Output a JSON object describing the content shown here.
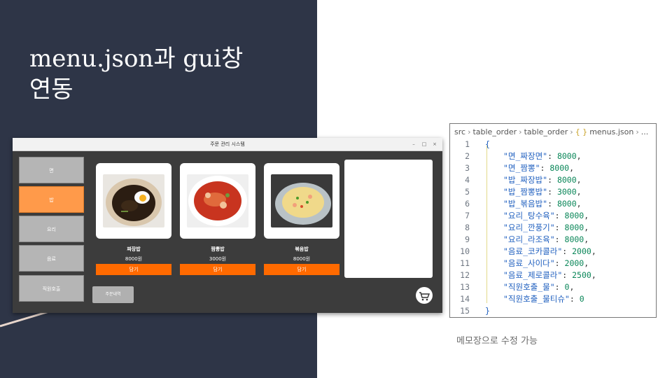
{
  "slide": {
    "title_line1": "menu.json과 gui창",
    "title_line2": "연동",
    "caption": "메모장으로 수정 가능",
    "colors": {
      "panel_bg": "#2e3547",
      "accent_orange": "#ff6a00",
      "active_category": "#ff9a4a"
    }
  },
  "app": {
    "window_title": "주문 관리 시스템",
    "window_controls": {
      "minimize": "–",
      "maximize": "□",
      "close": "×"
    },
    "categories": [
      {
        "label": "면",
        "active": false
      },
      {
        "label": "밥",
        "active": true
      },
      {
        "label": "요리",
        "active": false
      },
      {
        "label": "음료",
        "active": false
      },
      {
        "label": "직원호출",
        "active": false
      }
    ],
    "menu_items": [
      {
        "name": "짜장밥",
        "price": "8000원",
        "button": "담기",
        "image": "jjajang-rice-image"
      },
      {
        "name": "짬뽕밥",
        "price": "3000원",
        "button": "담기",
        "image": "jjamppong-rice-image"
      },
      {
        "name": "볶음밥",
        "price": "8000원",
        "button": "담기",
        "image": "fried-rice-image"
      }
    ],
    "order_history_button": "주문내역",
    "cart_icon": "shopping-cart-icon"
  },
  "editor": {
    "breadcrumb": [
      "src",
      "table_order",
      "table_order",
      "menus.json",
      "..."
    ],
    "breadcrumb_braces": "{ }",
    "lines": [
      {
        "no": "1",
        "key": "",
        "value": "",
        "text": "{"
      },
      {
        "no": "2",
        "key": "\"면_짜장면\"",
        "value": "8000",
        "sep": ","
      },
      {
        "no": "3",
        "key": "\"면_짬뽕\"",
        "value": "8000",
        "sep": ","
      },
      {
        "no": "4",
        "key": "\"밥_짜장밥\"",
        "value": "8000",
        "sep": ","
      },
      {
        "no": "5",
        "key": "\"밥_짬뽕밥\"",
        "value": "3000",
        "sep": ","
      },
      {
        "no": "6",
        "key": "\"밥_볶음밥\"",
        "value": "8000",
        "sep": ","
      },
      {
        "no": "7",
        "key": "\"요리_탕수육\"",
        "value": "8000",
        "sep": ","
      },
      {
        "no": "8",
        "key": "\"요리_깐풍기\"",
        "value": "8000",
        "sep": ","
      },
      {
        "no": "9",
        "key": "\"요리_라조육\"",
        "value": "8000",
        "sep": ","
      },
      {
        "no": "10",
        "key": "\"음료_코카콜라\"",
        "value": "2000",
        "sep": ","
      },
      {
        "no": "11",
        "key": "\"음료_사이다\"",
        "value": "2000",
        "sep": ","
      },
      {
        "no": "12",
        "key": "\"음료_제로콜라\"",
        "value": "2500",
        "sep": ","
      },
      {
        "no": "13",
        "key": "\"직원호출_물\"",
        "value": "0",
        "sep": ","
      },
      {
        "no": "14",
        "key": "\"직원호출_물티슈\"",
        "value": "0",
        "sep": ""
      },
      {
        "no": "15",
        "key": "",
        "value": "",
        "text": "}"
      }
    ]
  }
}
